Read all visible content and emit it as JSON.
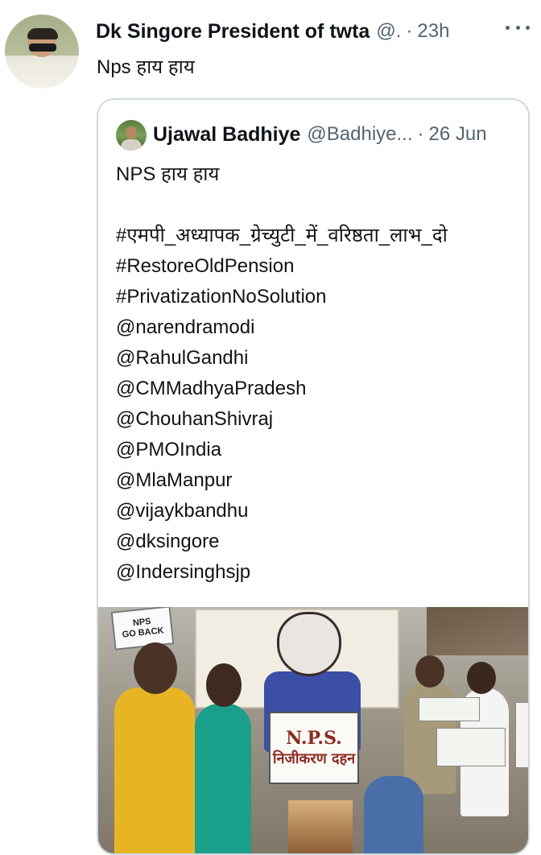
{
  "tweet": {
    "display_name": "Dk Singore President of twta",
    "handle": "@.",
    "separator": "·",
    "time": "23h",
    "text": "Nps हाय हाय",
    "more_icon": "more-horizontal-icon"
  },
  "quote": {
    "display_name": "Ujawal Badhiye",
    "handle": "@Badhiye...",
    "separator": "·",
    "time": "26 Jun",
    "lines": {
      "l1": "NPS हाय हाय",
      "l2": "#एमपी_अध्यापक_ग्रेच्युटी_में_वरिष्ठता_लाभ_दो",
      "l3": "#RestoreOldPension",
      "l4": "#PrivatizationNoSolution",
      "l5": "@narendramodi",
      "l6": "@RahulGandhi",
      "l7": "@CMMadhyaPradesh",
      "l8": "@ChouhanShivraj",
      "l9": "@PMOIndia",
      "l10": "@MlaManpur",
      "l11": "@vijaykbandhu",
      "l12": "@dksingore",
      "l13": "@Indersinghsjp"
    },
    "media": {
      "sign_line1": "N.P.S.",
      "sign_line2": "निजीकरण दहन",
      "go_back_line1": "NPS",
      "go_back_line2": "GO BACK"
    }
  },
  "colors": {
    "text_primary": "#0f1419",
    "text_secondary": "#536471",
    "border": "#cfd9de"
  }
}
